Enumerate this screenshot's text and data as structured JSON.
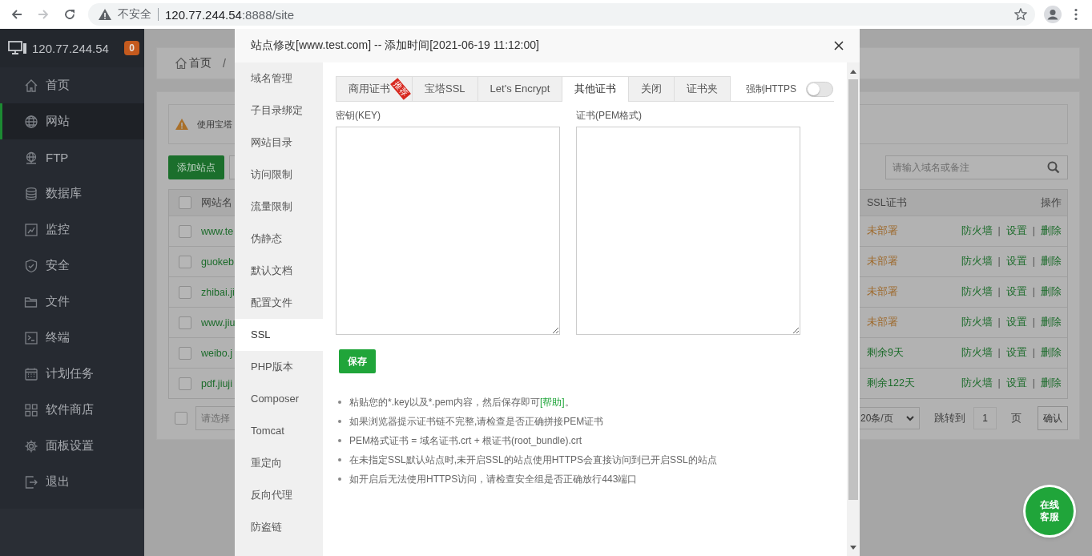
{
  "browser": {
    "security_label": "不安全",
    "url_host": "120.77.244.54",
    "url_rest": ":8888/site"
  },
  "sidebar": {
    "server": "120.77.244.54",
    "badge": "0",
    "items": [
      {
        "label": "首页",
        "selected": false
      },
      {
        "label": "网站",
        "selected": true
      },
      {
        "label": "FTP",
        "selected": false
      },
      {
        "label": "数据库",
        "selected": false
      },
      {
        "label": "监控",
        "selected": false
      },
      {
        "label": "安全",
        "selected": false
      },
      {
        "label": "文件",
        "selected": false
      },
      {
        "label": "终端",
        "selected": false
      },
      {
        "label": "计划任务",
        "selected": false
      },
      {
        "label": "软件商店",
        "selected": false
      },
      {
        "label": "面板设置",
        "selected": false
      },
      {
        "label": "退出",
        "selected": false
      }
    ]
  },
  "breadcrumb": {
    "home": "首页",
    "separator": "/"
  },
  "alert": {
    "text": "使用宝塔"
  },
  "toolbar": {
    "add_button": "添加站点",
    "search_placeholder": "请输入域名或备注"
  },
  "table": {
    "columns": {
      "name": "网站名",
      "ssl": "SSL证书",
      "actions": "操作"
    },
    "header_checked": false,
    "rows": [
      {
        "checked": false,
        "name": "www.te",
        "ssl": "未部署",
        "ssl_deployed": false,
        "actions": [
          "防火墙",
          "设置",
          "删除"
        ],
        "separator": "|"
      },
      {
        "checked": false,
        "name": "guokeb",
        "ssl": "未部署",
        "ssl_deployed": false,
        "actions": [
          "防火墙",
          "设置",
          "删除"
        ],
        "separator": "|"
      },
      {
        "checked": false,
        "name": "zhibai.ji",
        "ssl": "未部署",
        "ssl_deployed": false,
        "actions": [
          "防火墙",
          "设置",
          "删除"
        ],
        "separator": "|"
      },
      {
        "checked": false,
        "name": "www.jiu",
        "ssl": "未部署",
        "ssl_deployed": false,
        "actions": [
          "防火墙",
          "设置",
          "删除"
        ],
        "separator": "|"
      },
      {
        "checked": false,
        "name": "weibo.j",
        "ssl": "剩余9天",
        "ssl_deployed": true,
        "actions": [
          "防火墙",
          "设置",
          "删除"
        ],
        "separator": "|"
      },
      {
        "checked": false,
        "name": "pdf.jiuji",
        "ssl": "剩余122天",
        "ssl_deployed": true,
        "actions": [
          "防火墙",
          "设置",
          "删除"
        ],
        "separator": "|"
      }
    ]
  },
  "footer": {
    "all_checked": false,
    "batch_placeholder": "请选择",
    "page_size": "20条/页",
    "goto_label": "跳转到",
    "page": "1",
    "page_unit": "页",
    "confirm": "确认"
  },
  "modal": {
    "title": "站点修改[www.test.com] -- 添加时间[2021-06-19 11:12:00]",
    "nav": [
      {
        "label": "域名管理",
        "selected": false
      },
      {
        "label": "子目录绑定",
        "selected": false
      },
      {
        "label": "网站目录",
        "selected": false
      },
      {
        "label": "访问限制",
        "selected": false
      },
      {
        "label": "流量限制",
        "selected": false
      },
      {
        "label": "伪静态",
        "selected": false
      },
      {
        "label": "默认文档",
        "selected": false
      },
      {
        "label": "配置文件",
        "selected": false
      },
      {
        "label": "SSL",
        "selected": true
      },
      {
        "label": "PHP版本",
        "selected": false
      },
      {
        "label": "Composer",
        "selected": false
      },
      {
        "label": "Tomcat",
        "selected": false
      },
      {
        "label": "重定向",
        "selected": false
      },
      {
        "label": "反向代理",
        "selected": false
      },
      {
        "label": "防盗链",
        "selected": false
      }
    ],
    "tabs": [
      {
        "label": "商用证书",
        "selected": false,
        "ribbon": "推荐"
      },
      {
        "label": "宝塔SSL",
        "selected": false
      },
      {
        "label": "Let's Encrypt",
        "selected": false
      },
      {
        "label": "其他证书",
        "selected": true
      },
      {
        "label": "关闭",
        "selected": false
      },
      {
        "label": "证书夹",
        "selected": false
      }
    ],
    "force_https": {
      "label": "强制HTTPS",
      "on": false
    },
    "key_label": "密钥(KEY)",
    "cert_label": "证书(PEM格式)",
    "save": "保存",
    "notes": [
      {
        "text": "粘贴您的*.key以及*.pem内容，然后保存即可",
        "link": "[帮助]",
        "after": "。"
      },
      {
        "text": "如果浏览器提示证书链不完整,请检查是否正确拼接PEM证书"
      },
      {
        "text": "PEM格式证书 = 域名证书.crt + 根证书(root_bundle).crt"
      },
      {
        "text": "在未指定SSL默认站点时,未开启SSL的站点使用HTTPS会直接访问到已开启SSL的站点"
      },
      {
        "text": "如开启后无法使用HTTPS访问，请检查安全组是否正确放行443端口"
      }
    ]
  },
  "chat_button": "在线客服"
}
